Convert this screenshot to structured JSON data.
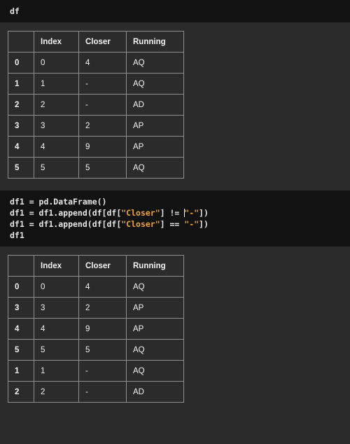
{
  "cells": [
    {
      "type": "code",
      "name": "code-cell-df",
      "lines": [
        [
          {
            "t": "df",
            "k": "plain"
          }
        ]
      ]
    },
    {
      "type": "table",
      "name": "dataframe-df",
      "columns": [
        "",
        "Index",
        "Closer",
        "Running"
      ],
      "rows": [
        {
          "label": "0",
          "Index": "0",
          "Closer": "4",
          "Running": "AQ"
        },
        {
          "label": "1",
          "Index": "1",
          "Closer": "-",
          "Running": "AQ"
        },
        {
          "label": "2",
          "Index": "2",
          "Closer": "-",
          "Running": "AD"
        },
        {
          "label": "3",
          "Index": "3",
          "Closer": "2",
          "Running": "AP"
        },
        {
          "label": "4",
          "Index": "4",
          "Closer": "9",
          "Running": "AP"
        },
        {
          "label": "5",
          "Index": "5",
          "Closer": "5",
          "Running": "AQ"
        }
      ]
    },
    {
      "type": "code",
      "name": "code-cell-df1",
      "lines": [
        [
          {
            "t": "df1 = pd.DataFrame()",
            "k": "plain"
          }
        ],
        [
          {
            "t": "df1 = df1.append(df[df[",
            "k": "plain"
          },
          {
            "t": "\"Closer\"",
            "k": "str"
          },
          {
            "t": "] != ",
            "k": "plain"
          },
          {
            "t": "",
            "k": "cursor"
          },
          {
            "t": "\"-\"",
            "k": "str"
          },
          {
            "t": "])",
            "k": "plain"
          }
        ],
        [
          {
            "t": "df1 = df1.append(df[df[",
            "k": "plain"
          },
          {
            "t": "\"Closer\"",
            "k": "str"
          },
          {
            "t": "] == ",
            "k": "plain"
          },
          {
            "t": "\"-\"",
            "k": "str"
          },
          {
            "t": "])",
            "k": "plain"
          }
        ],
        [
          {
            "t": "df1",
            "k": "plain"
          }
        ]
      ]
    },
    {
      "type": "table",
      "name": "dataframe-df1",
      "columns": [
        "",
        "Index",
        "Closer",
        "Running"
      ],
      "rows": [
        {
          "label": "0",
          "Index": "0",
          "Closer": "4",
          "Running": "AQ"
        },
        {
          "label": "3",
          "Index": "3",
          "Closer": "2",
          "Running": "AP"
        },
        {
          "label": "4",
          "Index": "4",
          "Closer": "9",
          "Running": "AP"
        },
        {
          "label": "5",
          "Index": "5",
          "Closer": "5",
          "Running": "AQ"
        },
        {
          "label": "1",
          "Index": "1",
          "Closer": "-",
          "Running": "AQ"
        },
        {
          "label": "2",
          "Index": "2",
          "Closer": "-",
          "Running": "AD"
        }
      ]
    }
  ],
  "colors": {
    "page_background": "#2b2b2b",
    "code_background": "#121212",
    "text": "#f2f2f2",
    "string_token": "#e8a33d",
    "table_border": "#8d8d8d",
    "cursor": "#ffffff"
  }
}
